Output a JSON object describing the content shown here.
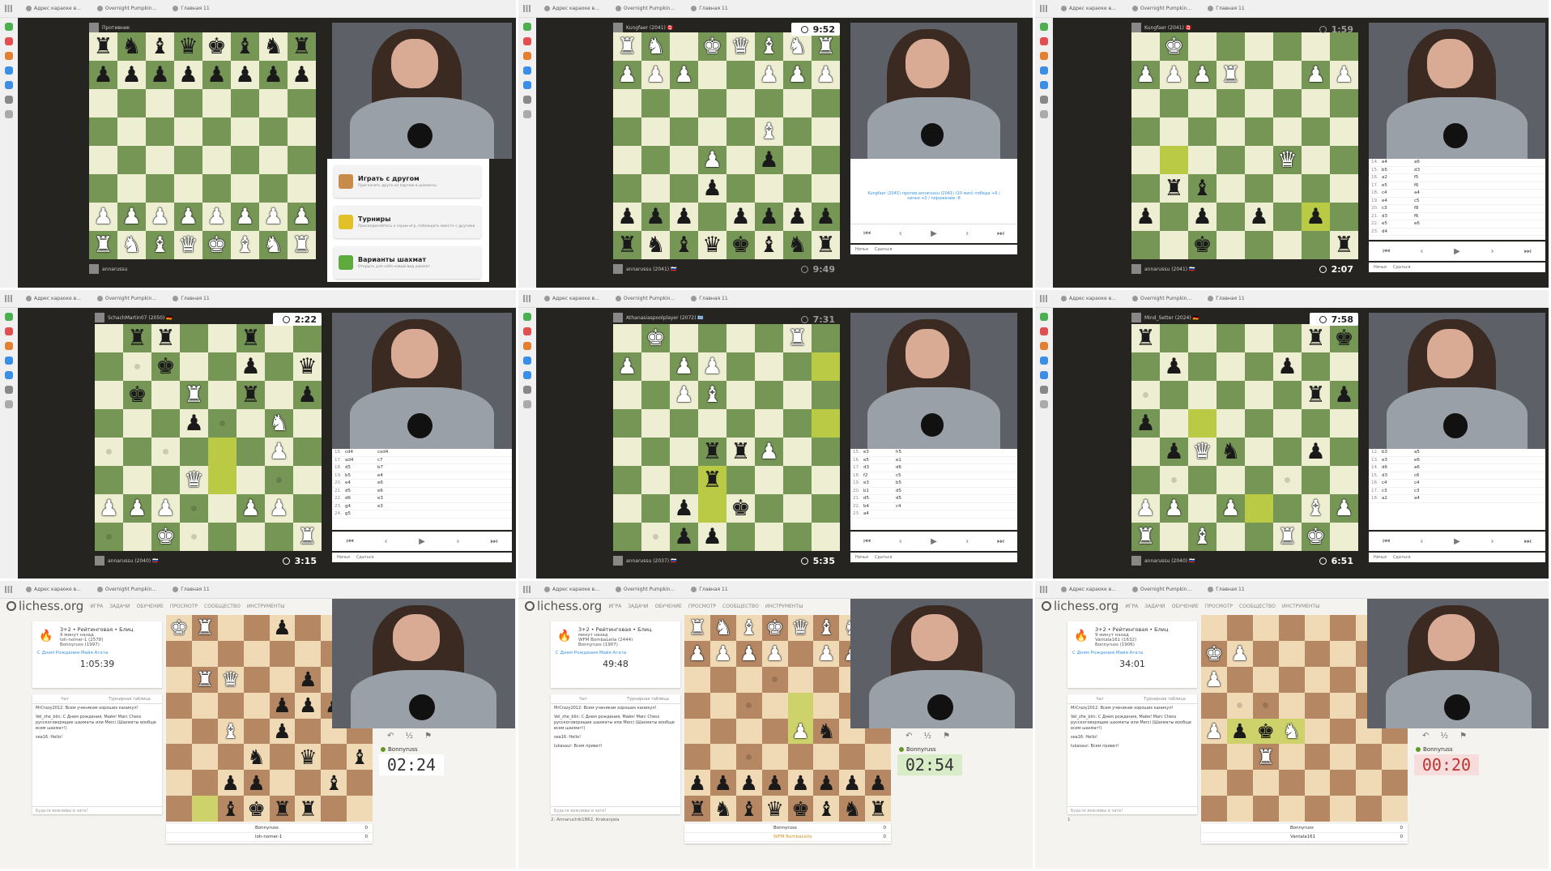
{
  "browser_tabs": [
    "Адрес караоке в...",
    "Overnight Pumpkin...",
    "Главная 11"
  ],
  "top": [
    {
      "top_player": "Противник",
      "bottom_player": "annarussu",
      "fen_rows": [
        "rnbqkbnr",
        "pppppppp",
        "........",
        "........",
        "........",
        "........",
        "PPPPPPPP",
        "RNBQKBNR"
      ],
      "menu": [
        {
          "title": "Играть с другом",
          "sub": "Пригласить друга на партию в шахматы",
          "color": "#c88b4a"
        },
        {
          "title": "Турниры",
          "sub": "Присоединяйтесь к серии игр, побеждать вместе с другими",
          "color": "#e2c028"
        },
        {
          "title": "Варианты шахмат",
          "sub": "Открыть для себя новый вид шахмат",
          "color": "#5eaa3c"
        }
      ]
    },
    {
      "top_player": "Kungfaer (2041) 🇨🇦",
      "bottom_player": "annarussu (2041) 🇷🇺",
      "top_clock": "9:52",
      "bottom_clock": "9:49",
      "fen_rows": [
        "RN.KQBNR",
        "PPP..PPP",
        "........",
        ".....B..",
        "...P.p..",
        "...p....",
        "ppp.pppp",
        "rnbqkbnr"
      ],
      "result_text": "Kungfaer (2041) против annarussu (2041) (10 мин) победа +6 / ничья +0 / поражение -8",
      "nav_labels": [
        "Ничья",
        "Сдаться"
      ]
    },
    {
      "top_player": "Kungfaer (2041) 🇨🇦",
      "bottom_player": "annarussu (2041) 🇷🇺",
      "top_clock": "1:59",
      "bottom_clock": "2:07",
      "fen_rows": [
        ".K......",
        "PPPR..PP",
        "........",
        "........",
        ".....Q..",
        ".rb.....",
        "p.p.p.p.",
        "..k....r"
      ],
      "moves": [
        [
          "14.",
          "e4",
          "a6"
        ],
        [
          "15.",
          "b5",
          "d3"
        ],
        [
          "16.",
          "a2",
          "f5"
        ],
        [
          "17.",
          "e5",
          "f6"
        ],
        [
          "18.",
          "c4",
          "a4"
        ],
        [
          "19.",
          "e4",
          "c5"
        ],
        [
          "20.",
          "c3",
          "f8"
        ],
        [
          "21.",
          "d3",
          "f6"
        ],
        [
          "22.",
          "e5",
          "e6"
        ],
        [
          "23.",
          "d4",
          ""
        ]
      ],
      "nav_labels": [
        "Ничья",
        "Сдаться"
      ]
    },
    {
      "top_player": "SchachMartin07 (2050) 🇩🇪",
      "bottom_player": "annarussu (2040) 🇷🇺",
      "top_clock": "2:22",
      "bottom_clock": "3:15",
      "fen_rows": [
        ".rr..r..",
        "..k..p.q",
        ".k.R.r.p",
        "...p..N.",
        "......P.",
        "...Q....",
        "PPP..PP.",
        "..K....R"
      ],
      "moves": [
        [
          "16.",
          "cd4",
          "cxd4"
        ],
        [
          "17.",
          "ad4",
          "c7"
        ],
        [
          "18.",
          "d5",
          "b7"
        ],
        [
          "19.",
          "b5",
          "e4"
        ],
        [
          "20.",
          "e4",
          "e6"
        ],
        [
          "21.",
          "d5",
          "e6"
        ],
        [
          "22.",
          "d6",
          "e3"
        ],
        [
          "23.",
          "g4",
          "e3"
        ],
        [
          "24.",
          "g5",
          ""
        ]
      ],
      "nav_labels": [
        "Ничья",
        "Сдаться"
      ]
    },
    {
      "top_player": "Athanasiaspoolplayer (2072) 🇬🇷",
      "bottom_player": "annarussu (2037) 🇷🇺",
      "top_clock": "7:31",
      "bottom_clock": "5:35",
      "fen_rows": [
        ".K....R.",
        "P.PP....",
        "..PB.",
        ".......",
        "...rrP..",
        "...r....",
        "..p.k...",
        "..pp...."
      ],
      "moves": [
        [
          "15.",
          "e3",
          "h5"
        ],
        [
          "16.",
          "e5",
          "e1"
        ],
        [
          "17.",
          "d3",
          "d6"
        ],
        [
          "18.",
          "f2",
          "c5"
        ],
        [
          "19.",
          "e3",
          "b5"
        ],
        [
          "20.",
          "b1",
          "d5"
        ],
        [
          "21.",
          "d5",
          "d5"
        ],
        [
          "22.",
          "b4",
          "c4"
        ],
        [
          "23.",
          "a4",
          ""
        ]
      ],
      "nav_labels": [
        "Ничья",
        "Сдаться"
      ]
    },
    {
      "top_player": "Mind_Setter (2024) 🇩🇪",
      "bottom_player": "annarussu (2040) 🇷🇺",
      "top_clock": "7:58",
      "bottom_clock": "6:51",
      "fen_rows": [
        "r.....rk",
        ".p...p..",
        "......rp",
        "p.......",
        ".pQn..p.",
        "........",
        "PP.P..BP",
        "R.B..RK."
      ],
      "moves": [
        [
          "12.",
          "b3",
          "a5"
        ],
        [
          "13.",
          "e3",
          "e6"
        ],
        [
          "14.",
          "d6",
          "a6"
        ],
        [
          "15.",
          "d3",
          "c6"
        ],
        [
          "16.",
          "c4",
          "c4"
        ],
        [
          "17.",
          "c3",
          "c3"
        ],
        [
          "18.",
          "a2",
          "a4"
        ]
      ],
      "nav_labels": [
        "Ничья",
        "Сдаться"
      ]
    }
  ],
  "lichess": {
    "logo": "lichess.org",
    "nav": [
      "ИГРА",
      "ЗАДАЧИ",
      "ОБУЧЕНИЕ",
      "ПРОСМОТР",
      "СООБЩЕСТВО",
      "ИНСТРУМЕНТЫ"
    ],
    "games": [
      {
        "title": "3+2 • Рейтинговая • Блиц",
        "ago": "9 минут назад",
        "p1": "loh-nomer-1 (2578)",
        "p2": "Bonnyruss (1997)",
        "bday": "С Днем Рождения Майя Агата",
        "time": "1:05:39",
        "chat_tabs": [
          "Чат",
          "Турнирная таблица"
        ],
        "chat": [
          "MrCrazy2012: Всем ученикам хороших каникул!",
          "Vel_zhe_blin: С Днем рождения, Майя! Marc Chess русскоговорящие шахматы или Merci (Шахматы вообще всем шахмат!)",
          "sea16: Hello!"
        ],
        "chat_placeholder": "Будьте вежливы в чате!",
        "clock": "02:24",
        "clock_state": "normal",
        "player": "Bonnyruss",
        "table": [
          [
            "Bonnyruss",
            "0"
          ],
          [
            "loh-nomer-1",
            "0"
          ]
        ],
        "fen_rows": [
          "KR..p...",
          "........",
          ".RQ..p..",
          "....ppp.",
          "..B.p...",
          "...n.q.b",
          "..pp..b.",
          "..bkrr.."
        ]
      },
      {
        "title": "3+2 • Рейтинговая • Блиц",
        "ago": "минут назад",
        "p1": "WFM BombaLeila (2444)",
        "p2": "Bonnyruss (1907)",
        "bday": "С Днем Рождения Майя Агата",
        "time": "49:48",
        "chat_tabs": [
          "Чат",
          "Турнирная таблица"
        ],
        "chat": [
          "MrCrazy2012: Всем ученикам хороших каникул!",
          "Vel_zhe_blin: С Днем рождения, Майя! Marc Chess русскоговорящие шахматы или Merci (Шахматы вообще всем шахмат!)",
          "sea16: Hello!",
          "lukasaur: Всем привет!"
        ],
        "chat_placeholder": "Будьте вежливы в чате!",
        "watchers": "2: Annaruchik1862, Krakanjala",
        "clock": "02:54",
        "clock_state": "run",
        "player": "Bonnyruss",
        "table": [
          [
            "Bonnyruss",
            "0"
          ],
          [
            "WFM BombaLeila",
            "0"
          ]
        ],
        "fen_rows": [
          "RNBKQBNR",
          "PPPP.PPP",
          ".......N",
          "........",
          "....Pn..",
          "........",
          "pppppppp",
          "rnbqkbnr"
        ]
      },
      {
        "title": "3+2 • Рейтинговая • Блиц",
        "ago": "9 минут назад",
        "p1": "Vantala161 (1632)",
        "p2": "Bonnyruss (1906)",
        "bday": "С Днем Рождения Майя Агата",
        "time": "34:01",
        "chat_tabs": [
          "Чат",
          "Турнирная таблица"
        ],
        "chat": [
          "MrCrazy2012: Всем ученикам хороших каникул!",
          "Vel_zhe_blin: С Днем рождения, Майя! Marc Chess русскоговорящие шахматы или Merci (Шахматы вообще всем шахмат!)",
          "sea16: Hello!",
          "lukasaur: Всем привет!"
        ],
        "chat_placeholder": "Будьте вежливы в чате!",
        "watchers": "1",
        "clock": "00:20",
        "clock_state": "low",
        "player": "Bonnyruss",
        "table": [
          [
            "Bonnyruss",
            "0"
          ],
          [
            "Vantala161",
            "0"
          ]
        ],
        "fen_rows": [
          "........",
          "KP......",
          "P.......",
          "........",
          "PpkN....",
          "..R.....",
          "........",
          "........"
        ]
      }
    ]
  },
  "colors": {
    "green_light": "#eeeed2",
    "green_dark": "#769656",
    "brown_light": "#f0d9b5",
    "brown_dark": "#b58863",
    "dark_bg": "#262421"
  }
}
